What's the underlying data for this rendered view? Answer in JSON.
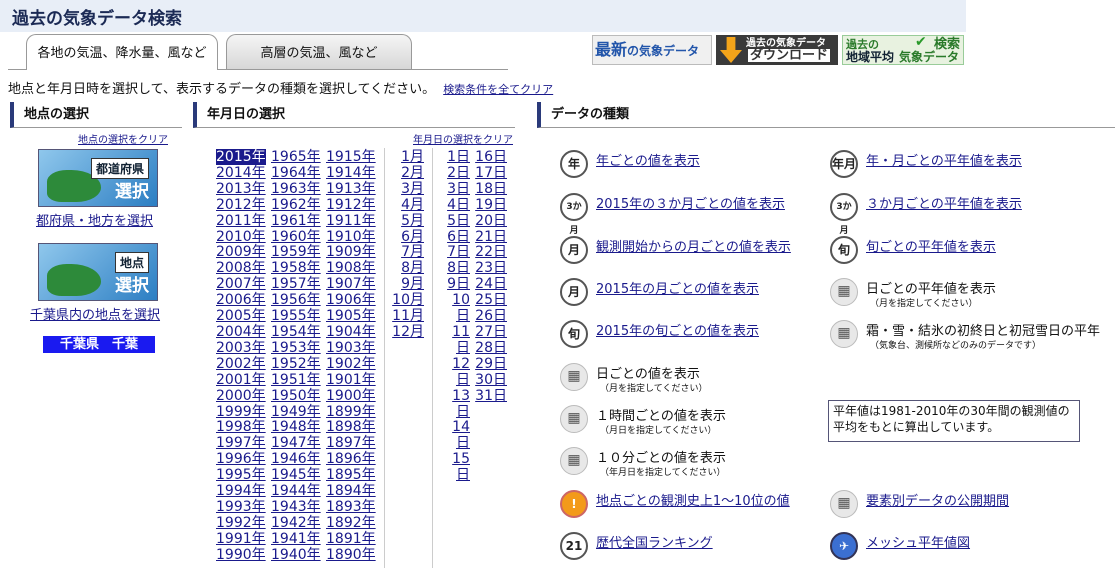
{
  "title": "過去の気象データ検索",
  "tabs": [
    {
      "label": "各地の気温、降水量、風など"
    },
    {
      "label": "高層の気温、風など"
    }
  ],
  "banners": {
    "latest": {
      "big": "最新",
      "rest": "の気象データ"
    },
    "download": {
      "line1": "過去の気象データ",
      "line2": "ダウンロード"
    },
    "regional": {
      "line1": "過去の",
      "line2": "地域平均",
      "line3": "気象データ",
      "search": "検索"
    }
  },
  "instruction": "地点と年月日時を選択して、表示するデータの種類を選択してください。",
  "clear_all": "検索条件を全てクリア",
  "sections": {
    "location": "地点の選択",
    "date": "年月日の選択",
    "datatype": "データの種類"
  },
  "location_clear": "地点の選択をクリア",
  "date_clear": "年月日の選択をクリア",
  "pref_img": {
    "label": "都道府県",
    "select": "選択"
  },
  "pref_link": "都府県・地方を選択",
  "point_img": {
    "label": "地点",
    "select": "選択"
  },
  "point_link": "千葉県内の地点を選択",
  "selected_location": "千葉県　千葉",
  "years_col1": [
    "2015年",
    "2014年",
    "2013年",
    "2012年",
    "2011年",
    "2010年",
    "2009年",
    "2008年",
    "2007年",
    "2006年",
    "2005年",
    "2004年",
    "2003年",
    "2002年",
    "2001年",
    "2000年",
    "1999年",
    "1998年",
    "1997年",
    "1996年",
    "1995年",
    "1994年",
    "1993年",
    "1992年",
    "1991年",
    "1990年"
  ],
  "years_col2": [
    "1965年",
    "1964年",
    "1963年",
    "1962年",
    "1961年",
    "1960年",
    "1959年",
    "1958年",
    "1957年",
    "1956年",
    "1955年",
    "1954年",
    "1953年",
    "1952年",
    "1951年",
    "1950年",
    "1949年",
    "1948年",
    "1947年",
    "1946年",
    "1945年",
    "1944年",
    "1943年",
    "1942年",
    "1941年",
    "1940年"
  ],
  "years_col3": [
    "1915年",
    "1914年",
    "1913年",
    "1912年",
    "1911年",
    "1910年",
    "1909年",
    "1908年",
    "1907年",
    "1906年",
    "1905年",
    "1904年",
    "1903年",
    "1902年",
    "1901年",
    "1900年",
    "1899年",
    "1898年",
    "1897年",
    "1896年",
    "1895年",
    "1894年",
    "1893年",
    "1892年",
    "1891年",
    "1890年"
  ],
  "months": [
    "1月",
    "2月",
    "3月",
    "4月",
    "5月",
    "6月",
    "7月",
    "8月",
    "9月",
    "10月",
    "11月",
    "12月"
  ],
  "days_a": [
    "1日",
    "2日",
    "3日",
    "4日",
    "5日",
    "6日",
    "7日",
    "8日",
    "9日",
    "10日",
    "11日",
    "12日",
    "13日",
    "14日",
    "15日"
  ],
  "days_b": [
    "16日",
    "17日",
    "18日",
    "19日",
    "20日",
    "21日",
    "22日",
    "23日",
    "24日",
    "25日",
    "26日",
    "27日",
    "28日",
    "29日",
    "30日",
    "31日"
  ],
  "datatypes_left": [
    {
      "icon": "年",
      "text": "年ごとの値を表示",
      "link": true
    },
    {
      "icon": "3か月",
      "text": "2015年の３か月ごとの値を表示",
      "link": true
    },
    {
      "icon": "月",
      "text": "観測開始からの月ごとの値を表示",
      "link": true
    },
    {
      "icon": "月",
      "text": "2015年の月ごとの値を表示",
      "link": true
    },
    {
      "icon": "旬",
      "text": "2015年の旬ごとの値を表示",
      "link": true
    },
    {
      "icon": "▦",
      "text": "日ごとの値を表示",
      "sub": "（月を指定してください）",
      "link": false
    },
    {
      "icon": "▦",
      "text": "１時間ごとの値を表示",
      "sub": "（月日を指定してください）",
      "link": false
    },
    {
      "icon": "▦",
      "text": "１０分ごとの値を表示",
      "sub": "（年月日を指定してください）",
      "link": false
    },
    {
      "icon": "!",
      "text": "地点ごとの観測史上1～10位の値",
      "link": true
    },
    {
      "icon": "21",
      "text": "歴代全国ランキング",
      "link": true
    }
  ],
  "datatypes_right": [
    {
      "icon": "年月",
      "text": "年・月ごとの平年値を表示",
      "link": true
    },
    {
      "icon": "3か月",
      "text": "３か月ごとの平年値を表示",
      "link": true
    },
    {
      "icon": "旬",
      "text": "旬ごとの平年値を表示",
      "link": true
    },
    {
      "icon": "▦",
      "text": "日ごとの平年値を表示",
      "sub": "（月を指定してください）",
      "link": false
    },
    {
      "icon": "▦",
      "text": "霜・雪・結氷の初終日と初冠雪日の平年",
      "sub": "（気象台、測候所などのみのデータです）",
      "link": false
    },
    {
      "icon": "▦",
      "text": "要素別データの公開期間",
      "link": true
    },
    {
      "icon": "✈",
      "text": "メッシュ平年値図",
      "link": true
    }
  ],
  "note": "平年値は1981-2010年の30年間の観測値の平均をもとに算出しています。"
}
